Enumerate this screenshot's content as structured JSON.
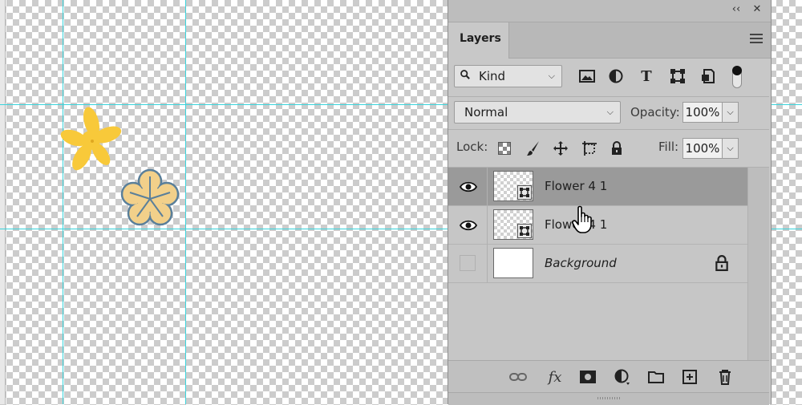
{
  "canvas": {
    "flowers": [
      {
        "name": "yellow-flower",
        "color": "#f8c93a"
      },
      {
        "name": "outlined-flower",
        "fill": "#f2d08a",
        "outline": "#5a7f9a"
      }
    ],
    "guide_color": "#39d4dc"
  },
  "panel": {
    "title": "Layers",
    "collapse_icon": "double-chevron-icon",
    "close_icon": "close-icon",
    "topbar_collapse": "‹‹",
    "topbar_close": "✕",
    "filter": {
      "kind_label": "Kind",
      "icons": [
        "image-filter-icon",
        "adjustment-filter-icon",
        "type-filter-icon",
        "shape-filter-icon",
        "smart-object-filter-icon"
      ]
    },
    "blend": {
      "mode": "Normal",
      "opacity_label": "Opacity:",
      "opacity_value": "100%"
    },
    "lock": {
      "label": "Lock:",
      "icons": [
        "lock-transparent-icon",
        "lock-image-icon",
        "lock-position-icon",
        "lock-artboard-icon",
        "lock-all-icon"
      ],
      "fill_label": "Fill:",
      "fill_value": "100%"
    },
    "layers": [
      {
        "name": "Flower 4 1",
        "visible": true,
        "selected": true,
        "type": "smart-object"
      },
      {
        "name": "Flower 4 1",
        "visible": true,
        "selected": false,
        "type": "smart-object",
        "partially_obscured": true
      },
      {
        "name": "Background",
        "visible": false,
        "selected": false,
        "type": "background",
        "locked": true
      }
    ],
    "footer_icons": [
      "link-layers-icon",
      "fx-icon",
      "mask-icon",
      "adjustment-layer-icon",
      "group-folder-icon",
      "new-layer-icon",
      "delete-icon"
    ],
    "fx_label": "fx"
  }
}
